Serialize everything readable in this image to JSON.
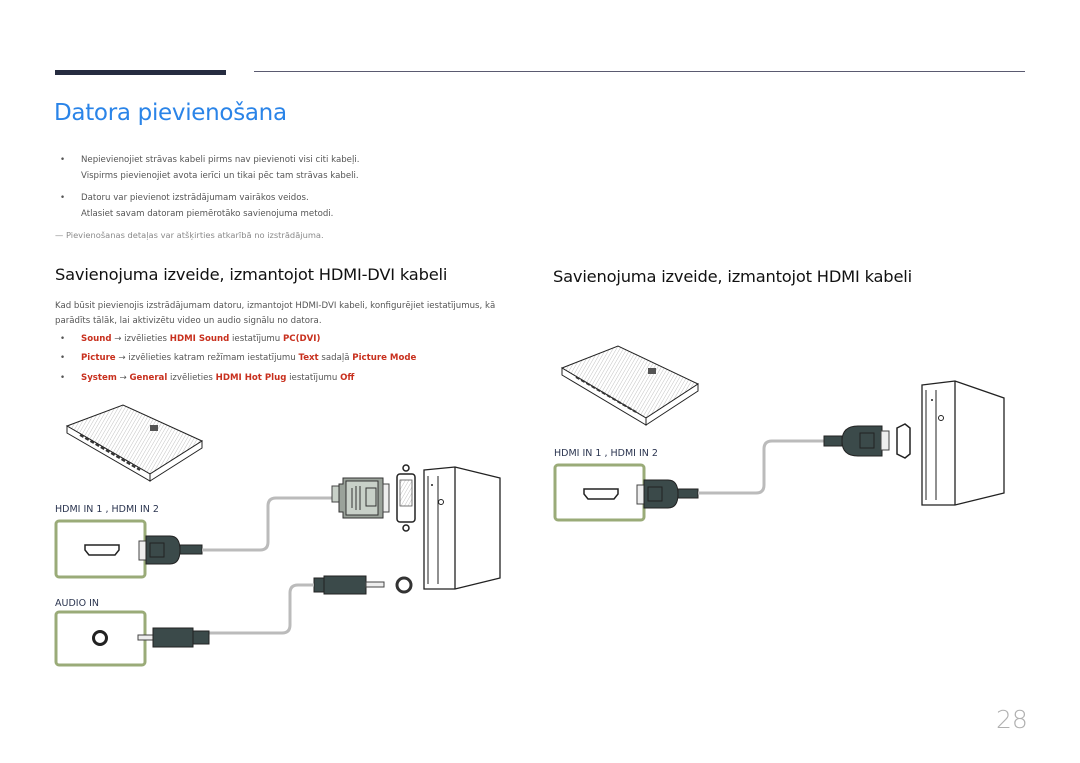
{
  "header": {
    "title": "Datora pievienošana"
  },
  "intro_bullets": [
    {
      "line1": "Nepievienojiet strāvas kabeli pirms nav pievienoti visi citi kabeļi.",
      "line2": "Vispirms pievienojiet avota ierīci un tikai pēc tam strāvas kabeli."
    },
    {
      "line1": "Datoru var pievienot izstrādājumam vairākos veidos.",
      "line2": "Atlasiet savam datoram piemērotāko savienojuma metodi."
    }
  ],
  "note": "Pievienošanas detaļas var atšķirties atkarībā no izstrādājuma.",
  "hdmi_dvi_section": {
    "heading": "Savienojuma izveide, izmantojot HDMI-DVI kabeli",
    "paragraph": "Kad būsit pievienojis izstrādājumam datoru, izmantojot HDMI-DVI kabeli, konfigurējiet iestatījumus, kā parādīts tālāk, lai aktivizētu video un audio signālu no datora.",
    "steps": [
      {
        "k1": "Sound",
        "arrow": " → izvēlieties ",
        "k2": "HDMI Sound",
        "mid": " iestatījumu ",
        "k3": "PC(DVI)",
        "mid2": "",
        "k4": ""
      },
      {
        "k1": "Picture",
        "arrow": " → izvēlieties katram režīmam iestatījumu ",
        "k2": "Text",
        "mid": " sadaļā ",
        "k3": "Picture Mode",
        "mid2": "",
        "k4": ""
      },
      {
        "k1": "System",
        "arrow": " → ",
        "k2": "General",
        "mid": " izvēlieties ",
        "k3": "HDMI Hot Plug",
        "mid2": " iestatījumu ",
        "k4": "Off"
      }
    ],
    "port_labels": {
      "hdmi": "HDMI IN 1 , HDMI IN 2",
      "audio": "AUDIO IN"
    }
  },
  "hdmi_section": {
    "heading": "Savienojuma izveide, izmantojot HDMI kabeli",
    "port_labels": {
      "hdmi": "HDMI IN 1 , HDMI IN 2"
    }
  },
  "footer": {
    "page_number": "28"
  },
  "colors": {
    "title_blue": "#2a84e8",
    "keyword_red": "#c8301e",
    "port_box_green": "#9aab78",
    "connector_dark": "#3b4a4a"
  }
}
